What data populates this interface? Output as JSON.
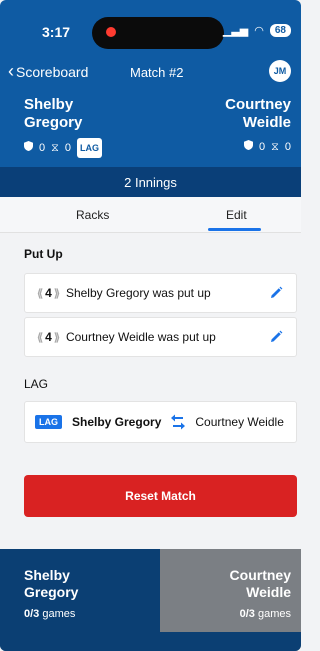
{
  "status_bar": {
    "time": "3:17",
    "signal_label": "▁▃▅",
    "wifi_label": "◠",
    "battery": "68"
  },
  "nav": {
    "back_label": "Scoreboard",
    "title": "Match #2",
    "avatar": "JM"
  },
  "players": {
    "left": {
      "first": "Shelby",
      "last": "Gregory",
      "stat1": "0",
      "stat2": "0",
      "badge": "LAG"
    },
    "right": {
      "first": "Courtney",
      "last": "Weidle",
      "stat1": "0",
      "stat2": "0"
    }
  },
  "innings": "2 Innings",
  "tabs": {
    "left": "Racks",
    "right": "Edit",
    "active": "Edit"
  },
  "put_up": {
    "title": "Put Up",
    "rows": [
      {
        "rank": "4",
        "text": "Shelby Gregory was put up"
      },
      {
        "rank": "4",
        "text": "Courtney Weidle was put up"
      }
    ]
  },
  "lag": {
    "title": "LAG",
    "tag": "LAG",
    "winner": "Shelby Gregory",
    "other": "Courtney Weidle"
  },
  "reset_button": "Reset Match",
  "footer": {
    "left": {
      "first": "Shelby",
      "last": "Gregory",
      "score": "0/3",
      "unit": "games"
    },
    "right": {
      "first": "Courtney",
      "last": "Weidle",
      "score": "0/3",
      "unit": "games"
    }
  },
  "colors": {
    "header": "#0f5ba3",
    "innings_bar": "#0a3f78",
    "accent": "#1a73e8",
    "danger": "#d92222",
    "footer_left": "#0b3f73",
    "footer_right": "#7b7f84"
  }
}
